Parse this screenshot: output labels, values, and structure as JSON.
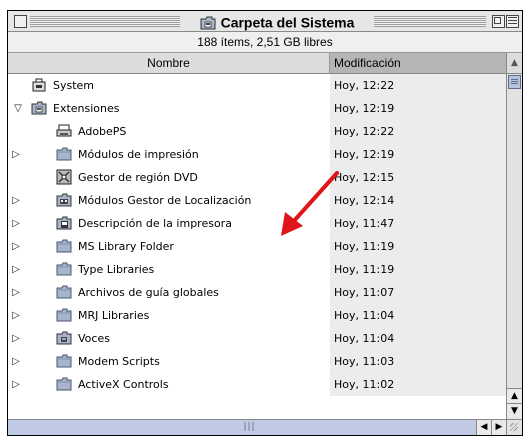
{
  "window": {
    "title": "Carpeta del Sistema",
    "info": "188 ítems, 2,51 GB libres"
  },
  "columns": {
    "name": "Nombre",
    "modified": "Modificación"
  },
  "colors": {
    "annotation_arrow": "#e0151a",
    "sorted_column_bg": "#b5b5b5",
    "scroll_thumb": "#b8c4dc"
  },
  "rows": [
    {
      "name": "System",
      "modified": "Hoy, 12:22",
      "icon": "system-suitcase-icon",
      "indent": 0,
      "disclosure": "none"
    },
    {
      "name": "Extensiones",
      "modified": "Hoy, 12:19",
      "icon": "extensions-folder-icon",
      "indent": 0,
      "disclosure": "expanded"
    },
    {
      "name": "AdobePS",
      "modified": "Hoy, 12:22",
      "icon": "printer-driver-icon",
      "indent": 1,
      "disclosure": "none"
    },
    {
      "name": "Módulos de impresión",
      "modified": "Hoy, 12:19",
      "icon": "folder-icon",
      "indent": 1,
      "disclosure": "collapsed"
    },
    {
      "name": "Gestor de región DVD",
      "modified": "Hoy, 12:15",
      "icon": "dvd-extension-icon",
      "indent": 1,
      "disclosure": "none"
    },
    {
      "name": "Módulos Gestor de Localización",
      "modified": "Hoy, 12:14",
      "icon": "location-folder-icon",
      "indent": 1,
      "disclosure": "collapsed"
    },
    {
      "name": "Descripción de la impresora",
      "modified": "Hoy, 11:47",
      "icon": "printer-folder-icon",
      "indent": 1,
      "disclosure": "collapsed"
    },
    {
      "name": "MS Library Folder",
      "modified": "Hoy, 11:19",
      "icon": "folder-icon",
      "indent": 1,
      "disclosure": "collapsed"
    },
    {
      "name": "Type Libraries",
      "modified": "Hoy, 11:19",
      "icon": "folder-icon",
      "indent": 1,
      "disclosure": "collapsed"
    },
    {
      "name": "Archivos de guía globales",
      "modified": "Hoy, 11:07",
      "icon": "folder-icon",
      "indent": 1,
      "disclosure": "collapsed"
    },
    {
      "name": "MRJ Libraries",
      "modified": "Hoy, 11:04",
      "icon": "folder-icon",
      "indent": 1,
      "disclosure": "collapsed"
    },
    {
      "name": "Voces",
      "modified": "Hoy, 11:04",
      "icon": "voices-folder-icon",
      "indent": 1,
      "disclosure": "collapsed"
    },
    {
      "name": "Modem Scripts",
      "modified": "Hoy, 11:03",
      "icon": "folder-icon",
      "indent": 1,
      "disclosure": "collapsed"
    },
    {
      "name": "ActiveX Controls",
      "modified": "Hoy, 11:02",
      "icon": "folder-icon",
      "indent": 1,
      "disclosure": "collapsed"
    }
  ]
}
